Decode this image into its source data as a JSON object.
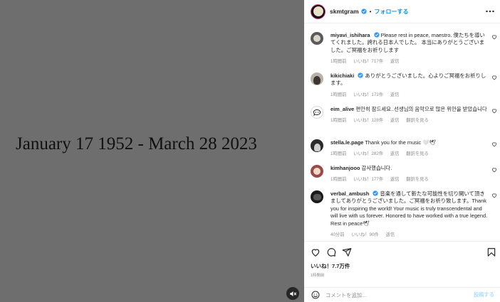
{
  "media": {
    "caption_text": "January 17 1952 - March 28 2023"
  },
  "post": {
    "username": "skmtgram",
    "separator": "•",
    "follow_label": "フォローする"
  },
  "comments": [
    {
      "username": "miyavi_ishihara",
      "verified": true,
      "text": "Please rest in peace, maestro. 僕たちを導いてくれました。誇れる日本人でした。 本当にありがとうございました。ご冥福をお祈りします",
      "time": "1時間前",
      "likes": "いいね！717件",
      "reply": "返信",
      "translate": ""
    },
    {
      "username": "kikichiaki",
      "verified": true,
      "text": "ありがとうございました。心よりご冥福をお祈りします。",
      "time": "1時間前",
      "likes": "いいね！172件",
      "reply": "返信",
      "translate": ""
    },
    {
      "username": "eim_alive",
      "verified": false,
      "text": "편안히 잠드세요..선생님의 음악으로 많은 위안을 받았습니다",
      "time": "1時間前",
      "likes": "いいね！128件",
      "reply": "返信",
      "translate": "翻訳を見る"
    },
    {
      "username": "stella.le.page",
      "verified": false,
      "text": "Thank you for the music 🤍🕊",
      "time": "1時間前",
      "likes": "いいね！282件",
      "reply": "返信",
      "translate": "翻訳を見る"
    },
    {
      "username": "kimhanjooo",
      "verified": false,
      "text": "감사했습니다.",
      "time": "1時間前",
      "likes": "いいね！177件",
      "reply": "返信",
      "translate": "翻訳を見る"
    },
    {
      "username": "verbal_ambush",
      "verified": true,
      "text": "音楽を通して新たな可能性を切り開いて頂きましてありがとうございました。ご冥福をお祈り致します。Thank you for inspiring the world! Your music is truly transcendental and will live with us forever. Honored to have worked with a true legend. Rest in peace🕊",
      "time": "40分前",
      "likes": "いいね！90件",
      "reply": "返信",
      "translate": ""
    }
  ],
  "footer": {
    "likes_count": "いいね！7.7万件",
    "time_ago": "1時間前",
    "comment_placeholder": "コメントを追加...",
    "post_label": "投稿する"
  },
  "colors": {
    "media_bg": "#6e6e6e",
    "link_blue": "#0095f6",
    "verified_blue": "#3897f0",
    "muted_text": "#8e8e8e"
  }
}
